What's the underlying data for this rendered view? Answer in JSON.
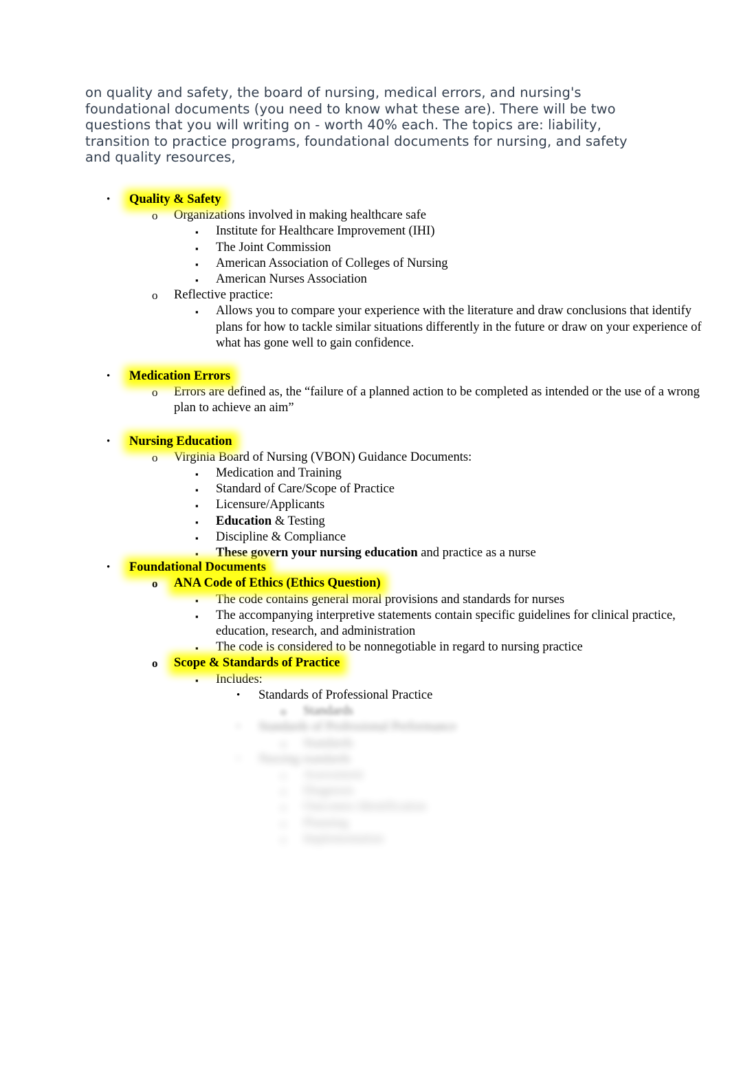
{
  "document": {
    "intro_paragraph": "on quality and safety, the board of nursing, medical errors, and nursing's foundational documents (you need to know what these are). There will be two questions that you will writing on - worth 40% each. The topics are: liability, transition to practice programs, foundational documents for nursing, and safety and quality resources,",
    "colors": {
      "intro_text": "#333f4f",
      "body_text": "#000000",
      "highlight": "#ffff00",
      "page_background": "#ffffff"
    },
    "markers": {
      "level1": "•",
      "level2": "o",
      "level3": "▪",
      "level4": "•",
      "level5": "o",
      "level6": "▪"
    }
  },
  "sections": {
    "quality_safety": {
      "heading": "Quality & Safety",
      "organizations_label": "Organizations involved in making healthcare safe",
      "organizations": [
        "Institute for Healthcare Improvement (IHI)",
        "The Joint Commission",
        "American Association of Colleges of Nursing",
        "American Nurses Association"
      ],
      "reflective_label": "Reflective practice:",
      "reflective_body": "Allows you to compare your experience with the literature and draw conclusions that identify plans for how to tackle similar situations differently in the future or draw on your experience of what has gone well to gain confidence."
    },
    "medication_errors": {
      "heading": "Medication Errors",
      "definition": "Errors are defined as, the “failure of a planned action to be completed as intended or the use of a wrong plan to achieve an aim”"
    },
    "nursing_education": {
      "heading": "Nursing Education",
      "vbon_label": "Virginia Board of Nursing (VBON) Guidance Documents:",
      "documents": [
        "Medication and Training",
        "Standard of Care/Scope of Practice",
        "Licensure/Applicants"
      ],
      "education_testing_bold": "Education",
      "education_testing_rest": " & Testing",
      "discipline": "Discipline & Compliance",
      "govern_bold": "These govern your nursing education",
      "govern_rest": " and practice as a nurse"
    },
    "foundational_documents": {
      "heading": "Foundational Documents",
      "ana_code": {
        "heading": "ANA Code of Ethics (Ethics Question)",
        "points": [
          "The code contains general moral provisions and standards for nurses",
          "The accompanying interpretive statements contain specific guidelines for clinical practice, education, research, and administration",
          "The code is considered to be nonnegotiable in regard to nursing practice"
        ]
      },
      "scope_standards": {
        "heading": "Scope & Standards of Practice",
        "includes_label": "Includes:",
        "standards_of_professional_practice": "Standards of Professional Practice",
        "faded_items": [
          "Standards",
          "Standards of Professional Performance",
          "Standards",
          "Nursing standards",
          "Assessment",
          "Diagnosis",
          "Outcomes Identification",
          "Planning",
          "Implementation"
        ]
      }
    }
  }
}
